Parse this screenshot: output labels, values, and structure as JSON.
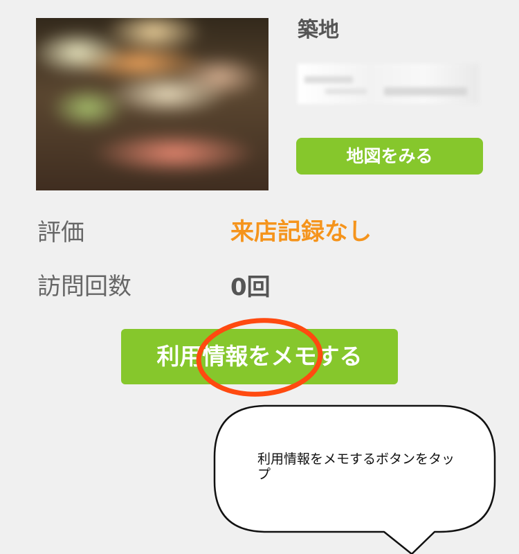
{
  "shop": {
    "name": "築地",
    "photo_icon": "sushi-photo"
  },
  "map_button": {
    "label": "地図をみる"
  },
  "info": {
    "rating_label": "評価",
    "rating_value": "来店記録なし",
    "visits_label": "訪問回数",
    "visits_value": "0回"
  },
  "memo_button": {
    "label": "利用情報をメモする"
  },
  "callout": {
    "text": "利用情報をメモするボタンをタップ"
  },
  "colors": {
    "background": "#f0f0f0",
    "button_green": "#86c72c",
    "rating_orange": "#f5941c",
    "highlight_red": "#ff4a10",
    "text_gray": "#555555"
  }
}
